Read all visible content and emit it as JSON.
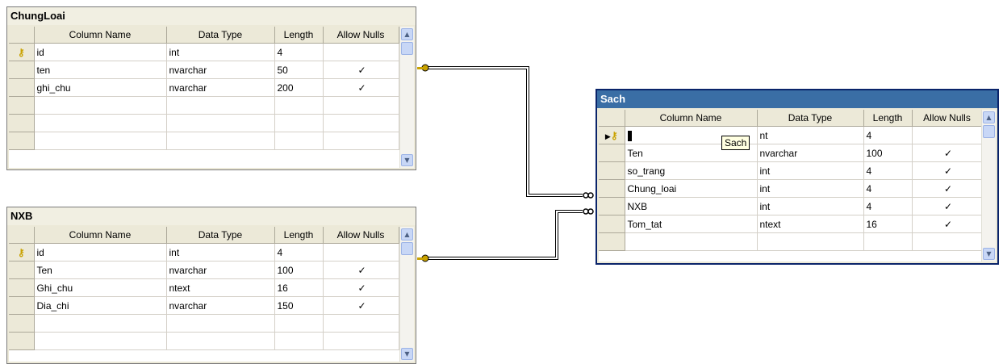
{
  "tables": {
    "chungloai": {
      "title": "ChungLoai",
      "headers": [
        "Column Name",
        "Data Type",
        "Length",
        "Allow Nulls"
      ],
      "rows": [
        {
          "key": true,
          "name": "id",
          "type": "int",
          "length": "4",
          "nulls": ""
        },
        {
          "key": false,
          "name": "ten",
          "type": "nvarchar",
          "length": "50",
          "nulls": "✓"
        },
        {
          "key": false,
          "name": "ghi_chu",
          "type": "nvarchar",
          "length": "200",
          "nulls": "✓"
        },
        {
          "key": false,
          "name": "",
          "type": "",
          "length": "",
          "nulls": ""
        },
        {
          "key": false,
          "name": "",
          "type": "",
          "length": "",
          "nulls": ""
        },
        {
          "key": false,
          "name": "",
          "type": "",
          "length": "",
          "nulls": ""
        }
      ]
    },
    "nxb": {
      "title": "NXB",
      "headers": [
        "Column Name",
        "Data Type",
        "Length",
        "Allow Nulls"
      ],
      "rows": [
        {
          "key": true,
          "name": "id",
          "type": "int",
          "length": "4",
          "nulls": ""
        },
        {
          "key": false,
          "name": "Ten",
          "type": "nvarchar",
          "length": "100",
          "nulls": "✓"
        },
        {
          "key": false,
          "name": "Ghi_chu",
          "type": "ntext",
          "length": "16",
          "nulls": "✓"
        },
        {
          "key": false,
          "name": "Dia_chi",
          "type": "nvarchar",
          "length": "150",
          "nulls": "✓"
        },
        {
          "key": false,
          "name": "",
          "type": "",
          "length": "",
          "nulls": ""
        },
        {
          "key": false,
          "name": "",
          "type": "",
          "length": "",
          "nulls": ""
        }
      ]
    },
    "sach": {
      "title": "Sach",
      "headers": [
        "Column Name",
        "Data Type",
        "Length",
        "Allow Nulls"
      ],
      "rows": [
        {
          "key": true,
          "name": "",
          "type": "nt",
          "length": "4",
          "nulls": ""
        },
        {
          "key": false,
          "name": "Ten",
          "type": "nvarchar",
          "length": "100",
          "nulls": "✓"
        },
        {
          "key": false,
          "name": "so_trang",
          "type": "int",
          "length": "4",
          "nulls": "✓"
        },
        {
          "key": false,
          "name": "Chung_loai",
          "type": "int",
          "length": "4",
          "nulls": "✓"
        },
        {
          "key": false,
          "name": "NXB",
          "type": "int",
          "length": "4",
          "nulls": "✓"
        },
        {
          "key": false,
          "name": "Tom_tat",
          "type": "ntext",
          "length": "16",
          "nulls": "✓"
        },
        {
          "key": false,
          "name": "",
          "type": "",
          "length": "",
          "nulls": ""
        }
      ]
    }
  },
  "tooltip": "Sach",
  "icons": {
    "key": "key-icon",
    "row_pointer": "row-pointer-icon",
    "scroll_up": "scroll-up-arrow-icon",
    "scroll_down": "scroll-down-arrow-icon"
  },
  "colors": {
    "active_title_bg": "#3a6ea5",
    "inactive_title_bg": "#f1efe2",
    "key_gold": "#c9a200"
  }
}
